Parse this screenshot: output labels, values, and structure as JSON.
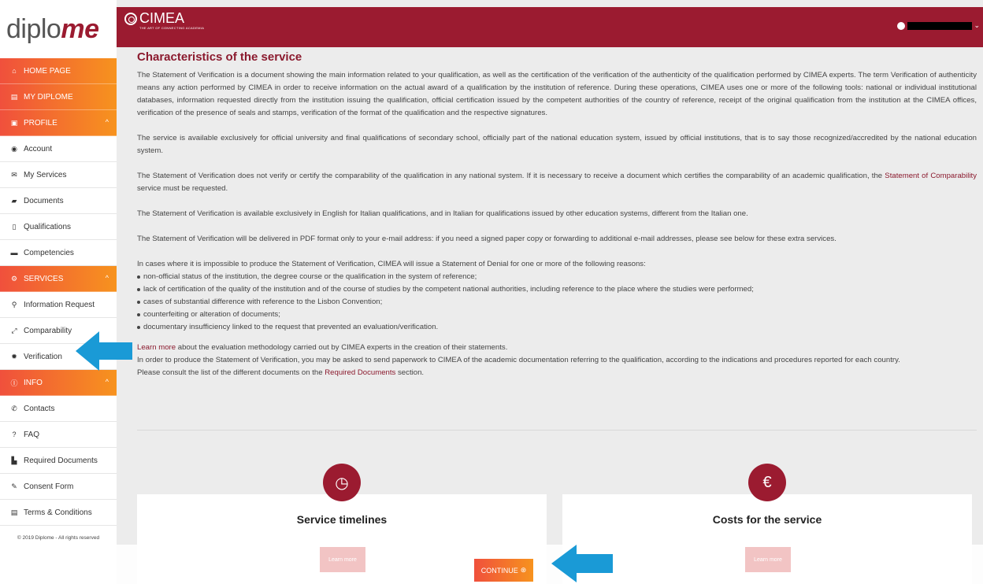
{
  "sidebar": {
    "logo_text": "diplo",
    "logo_accent": "me",
    "items": [
      {
        "label": "HOME PAGE",
        "icon": "home-icon"
      },
      {
        "label": "MY DIPLOME",
        "icon": "card-icon"
      },
      {
        "label": "PROFILE",
        "icon": "id-icon"
      },
      {
        "label": "Account",
        "icon": "account-icon"
      },
      {
        "label": "My Services",
        "icon": "envelope-icon"
      },
      {
        "label": "Documents",
        "icon": "book-icon"
      },
      {
        "label": "Qualifications",
        "icon": "file-icon"
      },
      {
        "label": "Competencies",
        "icon": "briefcase-icon"
      },
      {
        "label": "SERVICES",
        "icon": "gears-icon"
      },
      {
        "label": "Information Request",
        "icon": "search-icon"
      },
      {
        "label": "Comparability",
        "icon": "compare-icon"
      },
      {
        "label": "Verification",
        "icon": "badge-icon"
      },
      {
        "label": "INFO",
        "icon": "info-icon"
      },
      {
        "label": "Contacts",
        "icon": "phone-icon"
      },
      {
        "label": "FAQ",
        "icon": "question-icon"
      },
      {
        "label": "Required Documents",
        "icon": "document-icon"
      },
      {
        "label": "Consent Form",
        "icon": "pencil-icon"
      },
      {
        "label": "Terms & Conditions",
        "icon": "terms-icon"
      }
    ],
    "footer": "© 2019 Diplome - All rights reserved"
  },
  "header": {
    "brand": "CIMEA",
    "tagline": "THE ART OF CONNECTING ACADEMIA",
    "user_chevron": "⌄"
  },
  "content": {
    "title": "Characteristics of the service",
    "p1": "The Statement of Verification is a document showing the main information related to your qualification, as well as the certification of the verification of the authenticity of the qualification performed by CIMEA experts. The term Verification of authenticity means any action performed by CIMEA in order to receive information on the actual award of a qualification by the institution of reference. During these operations, CIMEA uses one or more of the following tools: national or individual institutional databases, information requested directly from the institution issuing the qualification, official certification issued by the competent authorities of the country of reference, receipt of the original qualification from the institution at the CIMEA offices, verification of the presence of seals and stamps, verification of the format of the qualification and the respective signatures.",
    "p2": "The service is available exclusively for official university and final qualifications of secondary school, officially part of the national education system, issued by official institutions, that is to say those recognized/accredited by the national education system.",
    "p3_before": "The Statement of Verification does not verify or certify the comparability of the qualification in any national system. If it is necessary to receive a document which certifies the comparability of an academic qualification, the ",
    "p3_link": "Statement of Comparability",
    "p3_after": " service must be requested.",
    "p4": "The Statement of Verification is available exclusively in English for Italian qualifications, and in Italian for qualifications issued by other education systems, different from the Italian one.",
    "p5": "The Statement of Verification will be delivered in PDF format only to your e-mail address: if you need a signed paper copy or forwarding to additional e-mail addresses, please see below for these extra services.",
    "p6": "In cases where it is impossible to produce the Statement of Verification, CIMEA will issue a Statement of Denial for one or more of the following reasons:",
    "reasons": [
      "non-official status of the institution, the degree course or the qualification in the system of reference;",
      "lack of certification of the quality of the institution and of the course of studies by the competent national authorities, including reference to the place where the studies were performed;",
      "cases of substantial difference with reference to the Lisbon Convention;",
      "counterfeiting or alteration of documents;",
      "documentary insufficiency linked to the request that prevented an evaluation/verification."
    ],
    "learn_more_link": "Learn more",
    "learn_more_after": " about the evaluation methodology carried out by CIMEA experts in the creation of their statements.",
    "p7": "In order to produce the Statement of Verification, you may be asked to send paperwork to CIMEA of the academic documentation referring to the qualification, according to the indications and procedures reported for each country.",
    "p8_before": "Please consult the list of the different documents on the ",
    "p8_link": "Required Documents",
    "p8_after": " section."
  },
  "cards": {
    "left_title": "Service timelines",
    "left_icon": "clock-icon",
    "left_icon_glyph": "◷",
    "right_title": "Costs for the service",
    "right_icon": "euro-icon",
    "right_icon_glyph": "€",
    "learn_more_label": "Learn more"
  },
  "footer_bar": {
    "continue_label": "CONTINUE",
    "continue_icon_glyph": "⊛"
  },
  "colors": {
    "brand": "#9b1b30",
    "orange_start": "#f0503c",
    "orange_end": "#f7931e",
    "arrow": "#1a9ad6"
  }
}
